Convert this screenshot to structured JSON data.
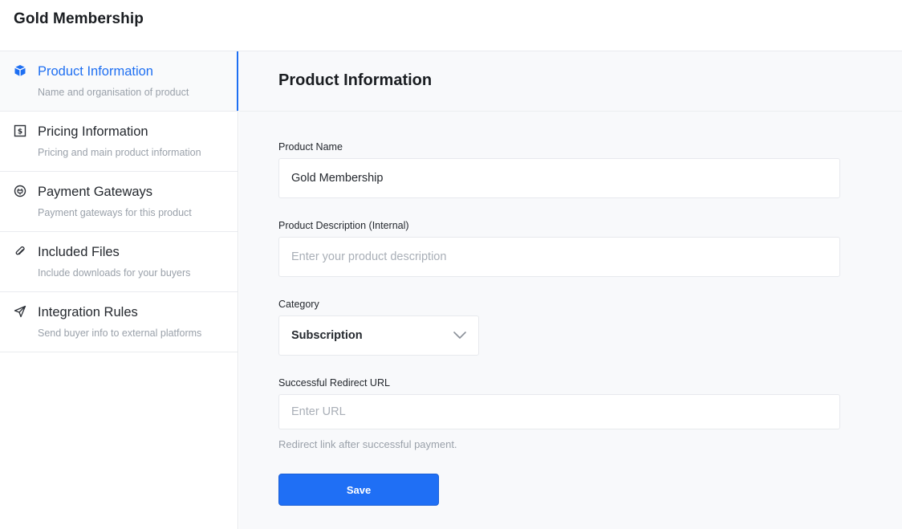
{
  "header": {
    "title": "Gold Membership"
  },
  "sidebar": {
    "items": [
      {
        "label": "Product Information",
        "sub": "Name and organisation of product",
        "icon": "box-icon",
        "active": true
      },
      {
        "label": "Pricing Information",
        "sub": "Pricing and main product information",
        "icon": "dollar-receipt-icon",
        "active": false
      },
      {
        "label": "Payment Gateways",
        "sub": "Payment gateways for this product",
        "icon": "plug-icon",
        "active": false
      },
      {
        "label": "Included Files",
        "sub": "Include downloads for your buyers",
        "icon": "paperclip-icon",
        "active": false
      },
      {
        "label": "Integration Rules",
        "sub": "Send buyer info to external platforms",
        "icon": "send-icon",
        "active": false
      }
    ]
  },
  "main": {
    "title": "Product Information",
    "fields": {
      "name": {
        "label": "Product Name",
        "value": "Gold Membership"
      },
      "description": {
        "label": "Product Description (Internal)",
        "value": "",
        "placeholder": "Enter your product description"
      },
      "category": {
        "label": "Category",
        "value": "Subscription"
      },
      "redirect": {
        "label": "Successful Redirect URL",
        "value": "",
        "placeholder": "Enter URL",
        "hint": "Redirect link after successful payment."
      }
    },
    "save_label": "Save"
  },
  "colors": {
    "accent": "#1e6ff2",
    "button": "#1f6ff5",
    "muted_text": "#9aa1aa"
  }
}
